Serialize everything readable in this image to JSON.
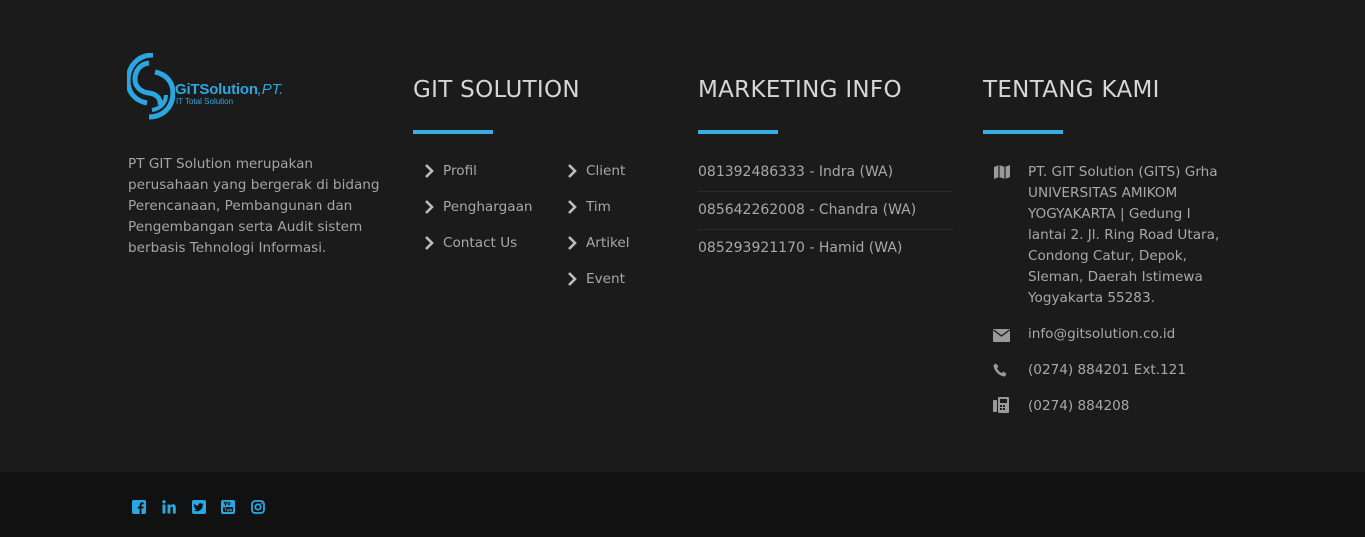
{
  "brand": {
    "logo_name": "GiTSolution",
    "logo_suffix": ",PT.",
    "logo_tagline": "IT Total Solution",
    "description": "PT GIT Solution merupakan perusahaan yang bergerak di bidang Perencanaan, Pembangunan dan Pengembangan serta Audit sistem berbasis Tehnologi Informasi.",
    "accent_color": "#2aa7e0"
  },
  "git_solution": {
    "title": "GIT SOLUTION",
    "links_left": [
      "Profil",
      "Penghargaan",
      "Contact Us"
    ],
    "links_right": [
      "Client",
      "Tim",
      "Artikel",
      "Event"
    ]
  },
  "marketing": {
    "title": "MARKETING INFO",
    "phones": [
      "081392486333 - Indra (WA)",
      "085642262008 - Chandra (WA)",
      "085293921170 - Hamid (WA)"
    ]
  },
  "about": {
    "title": "TENTANG KAMI",
    "address": "PT. GIT Solution (GITS) Grha UNIVERSITAS AMIKOM YOGYAKARTA | Gedung I lantai 2. Jl. Ring Road Utara, Condong Catur, Depok, Sleman, Daerah Istimewa Yogyakarta 55283.",
    "email": "info@gitsolution.co.id",
    "phone": "(0274) 884201 Ext.121",
    "fax": "(0274) 884208",
    "icons": [
      "map-icon",
      "envelope-icon",
      "phone-icon",
      "fax-icon"
    ]
  },
  "social": {
    "icons": [
      "facebook-icon",
      "linkedin-icon",
      "twitter-icon",
      "youtube-icon",
      "instagram-icon"
    ],
    "color": "#2aa7e0"
  }
}
